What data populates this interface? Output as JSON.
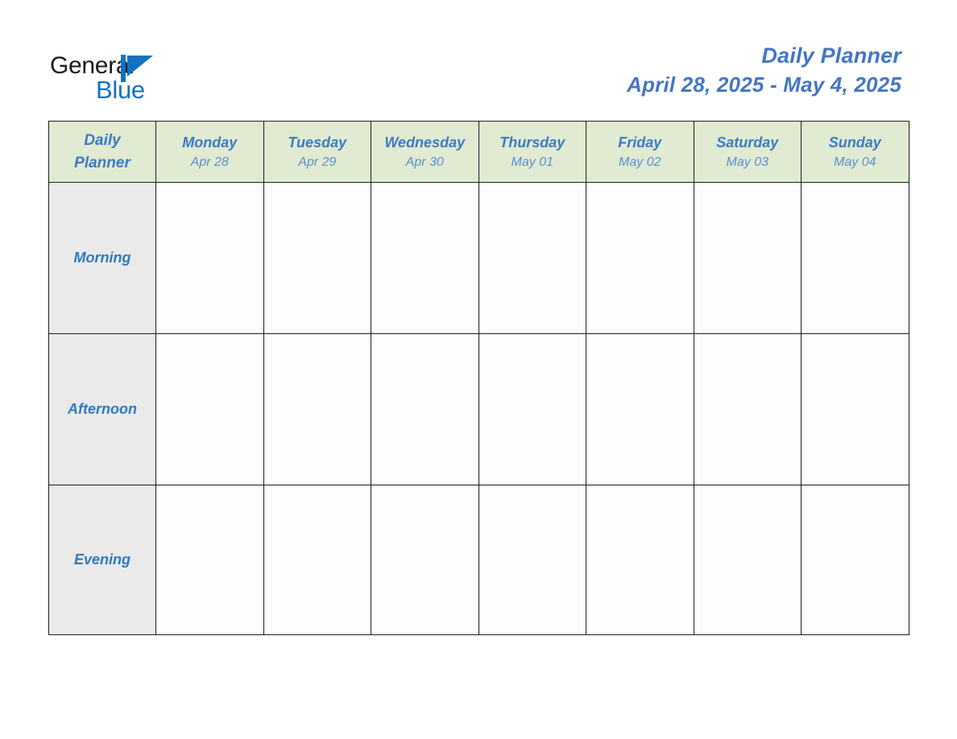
{
  "brand": {
    "name_part1": "General",
    "name_part2": "Blue",
    "logo_icon": "triangle-mark",
    "color_dark": "#1a1a1a",
    "color_blue": "#1272bf"
  },
  "header": {
    "title": "Daily Planner",
    "date_range": "April 28, 2025 - May 4, 2025",
    "title_color": "#4575c4"
  },
  "table": {
    "corner_label_line1": "Daily",
    "corner_label_line2": "Planner",
    "header_bg": "#e1ebd2",
    "label_bg": "#eaeaea",
    "cell_bg": "#fdfdfd",
    "border_color": "#1c1c1c",
    "day_name_color": "#3c7ac4",
    "day_date_color": "#5a8fd0",
    "slot_label_color": "#2e7ac0",
    "days": [
      {
        "name": "Monday",
        "date": "Apr 28"
      },
      {
        "name": "Tuesday",
        "date": "Apr 29"
      },
      {
        "name": "Wednesday",
        "date": "Apr 30"
      },
      {
        "name": "Thursday",
        "date": "May 01"
      },
      {
        "name": "Friday",
        "date": "May 02"
      },
      {
        "name": "Saturday",
        "date": "May 03"
      },
      {
        "name": "Sunday",
        "date": "May 04"
      }
    ],
    "slots": [
      {
        "label": "Morning",
        "entries": [
          "",
          "",
          "",
          "",
          "",
          "",
          ""
        ]
      },
      {
        "label": "Afternoon",
        "entries": [
          "",
          "",
          "",
          "",
          "",
          "",
          ""
        ]
      },
      {
        "label": "Evening",
        "entries": [
          "",
          "",
          "",
          "",
          "",
          "",
          ""
        ]
      }
    ]
  }
}
